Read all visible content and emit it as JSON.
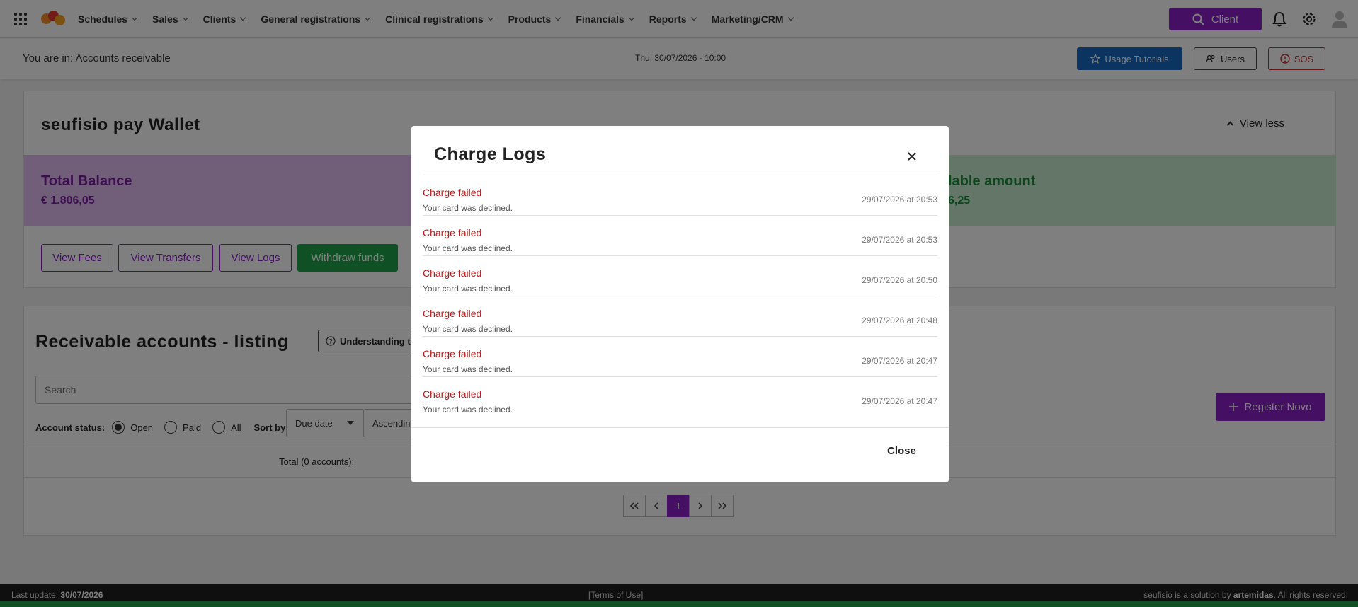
{
  "nav": {
    "items": [
      "Schedules",
      "Sales",
      "Clients",
      "General registrations",
      "Clinical registrations",
      "Products",
      "Financials",
      "Reports",
      "Marketing/CRM"
    ],
    "client_button": "Client",
    "brand_color": "#8a1ec9"
  },
  "subheader": {
    "breadcrumb": "You are in: Accounts receivable",
    "datetime": "Thu, 30/07/2026 - 10:00",
    "tutorials": "Usage Tutorials",
    "users": "Users",
    "sos": "SOS"
  },
  "wallet": {
    "title": "seufisio pay Wallet",
    "view_less": "View less",
    "total_label": "Total Balance",
    "total_value": "€ 1.806,05",
    "available_label": "lable amount",
    "available_value": "6,25",
    "buttons": {
      "fees": "View Fees",
      "transfers": "View Transfers",
      "logs": "View Logs",
      "withdraw": "Withdraw funds"
    }
  },
  "receivable": {
    "title": "Receivable accounts - listing",
    "understanding": "Understanding th",
    "search_placeholder": "Search",
    "status_label": "Account status:",
    "status_options": [
      "Open",
      "Paid",
      "All"
    ],
    "sort_label": "Sort by:",
    "sort_value": "Due date",
    "order_value": "Ascending",
    "register": "Register Novo",
    "total": "Total (0 accounts):",
    "current_page": "1"
  },
  "modal": {
    "title": "Charge Logs",
    "close": "Close",
    "logs": [
      {
        "title": "Charge failed",
        "message": "Your card was declined.",
        "date": "29/07/2026 at 20:53"
      },
      {
        "title": "Charge failed",
        "message": "Your card was declined.",
        "date": "29/07/2026 at 20:53"
      },
      {
        "title": "Charge failed",
        "message": "Your card was declined.",
        "date": "29/07/2026 at 20:50"
      },
      {
        "title": "Charge failed",
        "message": "Your card was declined.",
        "date": "29/07/2026 at 20:48"
      },
      {
        "title": "Charge failed",
        "message": "Your card was declined.",
        "date": "29/07/2026 at 20:47"
      },
      {
        "title": "Charge failed",
        "message": "Your card was declined.",
        "date": "29/07/2026 at 20:47"
      }
    ]
  },
  "footer": {
    "last_update_label": "Last update:",
    "last_update_value": "30/07/2026",
    "terms": "[Terms of Use]",
    "credit_prefix": "seufisio is a solution by",
    "credit_brand": "artemidas",
    "credit_suffix": ". All rights reserved."
  }
}
